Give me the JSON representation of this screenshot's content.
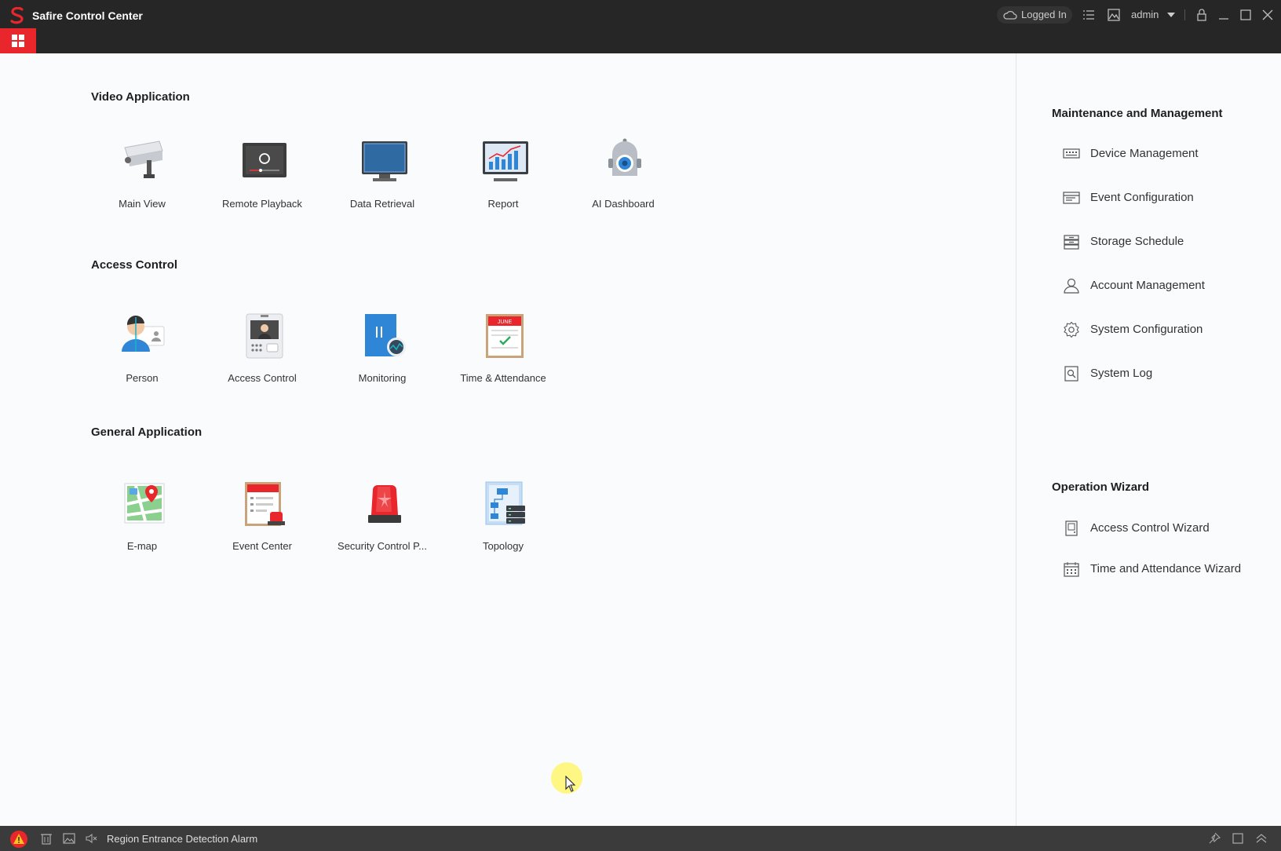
{
  "titlebar": {
    "app_title": "Safire Control Center",
    "status": "Logged In",
    "user": "admin",
    "brand_color": "#e8262b"
  },
  "sections": {
    "video": {
      "title": "Video Application",
      "items": [
        {
          "label": "Main View",
          "icon": "camera-icon"
        },
        {
          "label": "Remote Playback",
          "icon": "playback-icon"
        },
        {
          "label": "Data Retrieval",
          "icon": "monitor-icon"
        },
        {
          "label": "Report",
          "icon": "report-chart-icon"
        },
        {
          "label": "AI Dashboard",
          "icon": "robot-icon"
        }
      ]
    },
    "access": {
      "title": "Access Control",
      "items": [
        {
          "label": "Person",
          "icon": "person-icon"
        },
        {
          "label": "Access Control",
          "icon": "intercom-icon"
        },
        {
          "label": "Monitoring",
          "icon": "door-monitor-icon"
        },
        {
          "label": "Time & Attendance",
          "icon": "calendar-icon"
        }
      ]
    },
    "general": {
      "title": "General Application",
      "items": [
        {
          "label": "E-map",
          "icon": "map-icon"
        },
        {
          "label": "Event Center",
          "icon": "event-list-icon"
        },
        {
          "label": "Security Control P...",
          "icon": "alarm-siren-icon"
        },
        {
          "label": "Topology",
          "icon": "topology-icon"
        }
      ]
    }
  },
  "right_panel": {
    "maintenance": {
      "title": "Maintenance and Management",
      "items": [
        {
          "label": "Device Management",
          "icon": "device-icon"
        },
        {
          "label": "Event Configuration",
          "icon": "event-config-icon"
        },
        {
          "label": "Storage Schedule",
          "icon": "storage-icon"
        },
        {
          "label": "Account Management",
          "icon": "account-icon"
        },
        {
          "label": "System Configuration",
          "icon": "gear-icon"
        },
        {
          "label": "System Log",
          "icon": "log-icon"
        }
      ]
    },
    "wizard": {
      "title": "Operation Wizard",
      "items": [
        {
          "label": "Access Control Wizard",
          "icon": "door-icon"
        },
        {
          "label": "Time and Attendance Wizard",
          "icon": "calendar-grid-icon"
        }
      ]
    }
  },
  "statusbar": {
    "alarm_text": "Region Entrance Detection Alarm"
  },
  "calendar_month": "JUNE"
}
